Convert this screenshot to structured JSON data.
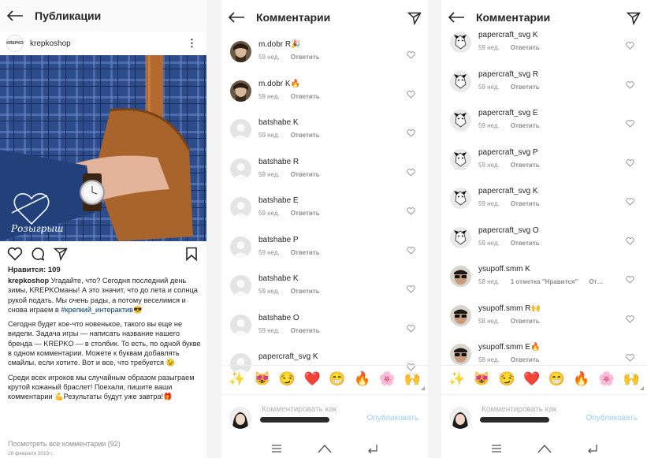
{
  "post_screen": {
    "header": {
      "title": "Публикации"
    },
    "author": {
      "name": "krepkoshop",
      "avatar_text": "KREPKO"
    },
    "photo": {
      "watermark": "Розыгрыш"
    },
    "likes": "Нравится: 109",
    "caption": {
      "user": "krepkoshop",
      "p1": " Угадайте, что? Сегодня последний день зимы, KREPKOманы! А это значит,  что до лета и солнца рукой подать. Мы очень рады, а потому веселимся и снова играем в ",
      "hashtag": "#крепкий_интерактив",
      "p1_end": "😎",
      "p2": "Сегодня будет кое-что новенькое, такого вы еще не видели. Задача игры — написать название нашего бренда — KREPKO — в столбик. То есть, по одной букве в одном комментарии. Можете к буквам добавлять смайлы, если хотите. Вот и все, что требуется 😉",
      "p3": "Среди всех игроков мы случайным образом разыграем крутой кожаный браслет! Поехали, пишите ваши комментарии 💪Результаты будут уже завтра!🎁"
    },
    "view_all": "Посмотреть все комментарии (92)",
    "date": "28 февраля 2019 г."
  },
  "comments_screen_1": {
    "header": {
      "title": "Комментарии"
    },
    "comments": [
      {
        "user": "m.dobr",
        "text": " R🎉",
        "time": "59 нед.",
        "reply": "Ответить",
        "avatar": "photo"
      },
      {
        "user": "m.dobr",
        "text": " K🔥",
        "time": "59 нед.",
        "reply": "Ответить",
        "avatar": "photo"
      },
      {
        "user": "batshabe",
        "text": " K",
        "time": "59 нед.",
        "reply": "Ответить",
        "avatar": "default"
      },
      {
        "user": "batshabe",
        "text": " R",
        "time": "59 нед.",
        "reply": "Ответить",
        "avatar": "default"
      },
      {
        "user": "batshabe",
        "text": " E",
        "time": "59 нед.",
        "reply": "Ответить",
        "avatar": "default"
      },
      {
        "user": "batshabe",
        "text": " P",
        "time": "59 нед.",
        "reply": "Ответить",
        "avatar": "default"
      },
      {
        "user": "batshabe",
        "text": " K",
        "time": "59 нед.",
        "reply": "Ответить",
        "avatar": "default"
      },
      {
        "user": "batshabe",
        "text": " O",
        "time": "59 нед.",
        "reply": "Ответить",
        "avatar": "default"
      },
      {
        "user": "papercraft_svg",
        "text": " K",
        "time": "",
        "reply": "",
        "avatar": "default"
      }
    ],
    "input": {
      "placeholder": "Комментировать как",
      "publish": "Опубликовать"
    }
  },
  "comments_screen_2": {
    "header": {
      "title": "Комментарии"
    },
    "comments": [
      {
        "user": "papercraft_svg",
        "text": " K",
        "time": "59 нед.",
        "reply": "Ответить",
        "avatar": "paper"
      },
      {
        "user": "papercraft_svg",
        "text": " R",
        "time": "59 нед.",
        "reply": "Ответить",
        "avatar": "paper"
      },
      {
        "user": "papercraft_svg",
        "text": " E",
        "time": "59 нед.",
        "reply": "Ответить",
        "avatar": "paper"
      },
      {
        "user": "papercraft_svg",
        "text": " P",
        "time": "59 нед.",
        "reply": "Ответить",
        "avatar": "paper"
      },
      {
        "user": "papercraft_svg",
        "text": " K",
        "time": "59 нед.",
        "reply": "Ответить",
        "avatar": "paper"
      },
      {
        "user": "papercraft_svg",
        "text": " O",
        "time": "59 нед.",
        "reply": "Ответить",
        "avatar": "paper"
      },
      {
        "user": "ysupoff.smm",
        "text": " K",
        "time": "58 нед.",
        "likes": "1 отметка \"Нравится\"",
        "more": "От…",
        "avatar": "sun"
      },
      {
        "user": "ysupoff.smm",
        "text": " R🙌",
        "time": "58 нед.",
        "reply": "Ответить",
        "avatar": "sun"
      },
      {
        "user": "ysupoff.smm",
        "text": " E🔥",
        "time": "58 нед.",
        "reply": "Ответить",
        "avatar": "sun"
      }
    ],
    "input": {
      "placeholder": "Комментировать как",
      "publish": "Опубликовать"
    }
  },
  "emoji_bar": [
    "✨",
    "😻",
    "😏",
    "❤️",
    "😁",
    "🔥",
    "🌸",
    "🙌"
  ],
  "colors": {
    "link": "#00376b",
    "muted": "#8e8e8e",
    "publish": "#9fcdf0"
  }
}
